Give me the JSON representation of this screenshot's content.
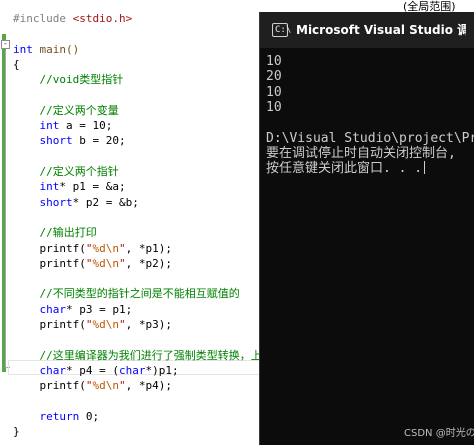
{
  "editor": {
    "top_note": "(全局范围)",
    "fold_marker": "-",
    "lines": [
      {
        "parts": [
          {
            "t": "#include ",
            "c": "pp"
          },
          {
            "t": "<stdio.h>",
            "c": "st"
          }
        ]
      },
      {
        "parts": []
      },
      {
        "parts": [
          {
            "t": "int",
            "c": "kw"
          },
          {
            "t": " main()",
            "c": "fn"
          }
        ]
      },
      {
        "parts": [
          {
            "t": "{",
            "c": "nm"
          }
        ]
      },
      {
        "parts": [
          {
            "t": "    //void类型指针",
            "c": "cm"
          }
        ]
      },
      {
        "parts": []
      },
      {
        "parts": [
          {
            "t": "    //定义两个变量",
            "c": "cm"
          }
        ]
      },
      {
        "parts": [
          {
            "t": "    int",
            "c": "kw"
          },
          {
            "t": " a = 10;",
            "c": "nm"
          }
        ]
      },
      {
        "parts": [
          {
            "t": "    short",
            "c": "kw"
          },
          {
            "t": " b = 20;",
            "c": "nm"
          }
        ]
      },
      {
        "parts": []
      },
      {
        "parts": [
          {
            "t": "    //定义两个指针",
            "c": "cm"
          }
        ]
      },
      {
        "parts": [
          {
            "t": "    int",
            "c": "kw"
          },
          {
            "t": "* p1 = &a;",
            "c": "nm"
          }
        ]
      },
      {
        "parts": [
          {
            "t": "    short",
            "c": "kw"
          },
          {
            "t": "* p2 = &b;",
            "c": "nm"
          }
        ]
      },
      {
        "parts": []
      },
      {
        "parts": [
          {
            "t": "    //输出打印",
            "c": "cm"
          }
        ]
      },
      {
        "parts": [
          {
            "t": "    printf(",
            "c": "nm"
          },
          {
            "t": "\"",
            "c": "st"
          },
          {
            "t": "%d\\n",
            "c": "es"
          },
          {
            "t": "\"",
            "c": "st"
          },
          {
            "t": ", *p1);",
            "c": "nm"
          }
        ]
      },
      {
        "parts": [
          {
            "t": "    printf(",
            "c": "nm"
          },
          {
            "t": "\"",
            "c": "st"
          },
          {
            "t": "%d\\n",
            "c": "es"
          },
          {
            "t": "\"",
            "c": "st"
          },
          {
            "t": ", *p2);",
            "c": "nm"
          }
        ]
      },
      {
        "parts": []
      },
      {
        "parts": [
          {
            "t": "    //不同类型的指针之间是不能相互赋值的",
            "c": "cm"
          }
        ]
      },
      {
        "parts": [
          {
            "t": "    char",
            "c": "kw"
          },
          {
            "t": "* p3 = p1;",
            "c": "nm"
          }
        ]
      },
      {
        "parts": [
          {
            "t": "    printf(",
            "c": "nm"
          },
          {
            "t": "\"",
            "c": "st"
          },
          {
            "t": "%d\\n",
            "c": "es"
          },
          {
            "t": "\"",
            "c": "st"
          },
          {
            "t": ", *p3);",
            "c": "nm"
          }
        ]
      },
      {
        "parts": []
      },
      {
        "parts": [
          {
            "t": "    //这里编译器为我们进行了强制类型转换，上",
            "c": "cm"
          }
        ]
      },
      {
        "parts": [
          {
            "t": "    char",
            "c": "kw"
          },
          {
            "t": "* p4 = (",
            "c": "nm"
          },
          {
            "t": "char",
            "c": "kw"
          },
          {
            "t": "*)p1;",
            "c": "nm"
          }
        ]
      },
      {
        "parts": [
          {
            "t": "    printf(",
            "c": "nm"
          },
          {
            "t": "\"",
            "c": "st"
          },
          {
            "t": "%d\\n",
            "c": "es"
          },
          {
            "t": "\"",
            "c": "st"
          },
          {
            "t": ", *p4);",
            "c": "nm"
          }
        ]
      },
      {
        "parts": []
      },
      {
        "parts": [
          {
            "t": "    return",
            "c": "kw"
          },
          {
            "t": " 0;",
            "c": "nm"
          }
        ]
      },
      {
        "parts": [
          {
            "t": "}",
            "c": "nm"
          }
        ]
      }
    ]
  },
  "console": {
    "title": "Microsoft Visual Studio 调试控",
    "icon_glyph": "C:\\",
    "output": [
      "10",
      "20",
      "10",
      "10",
      "",
      "D:\\Visual Studio\\project\\Proj",
      "要在调试停止时自动关闭控制台,",
      "按任意键关闭此窗口. . ."
    ]
  },
  "watermark": "CSDN @时光の尘"
}
